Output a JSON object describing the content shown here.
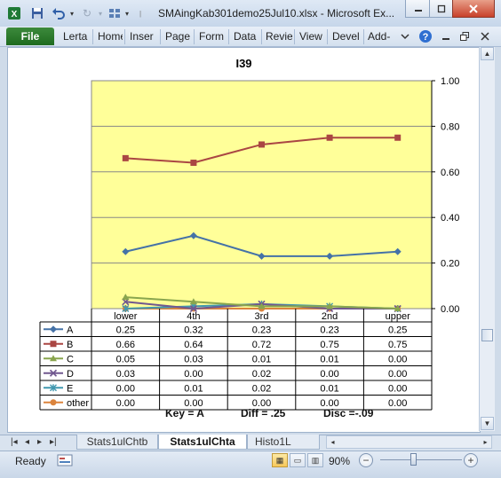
{
  "window": {
    "title": "SMAingKab301demo25Jul10.xlsx  -  Microsoft Ex..."
  },
  "ribbon": {
    "file_tab": "File",
    "tabs": [
      "Lerta",
      "Home",
      "Inser",
      "Page",
      "Form",
      "Data",
      "Revie",
      "View",
      "Devel",
      "Add-"
    ]
  },
  "icons": {
    "app": "excel-icon",
    "save": "save-icon",
    "undo": "undo-icon",
    "redo": "redo-icon",
    "customize": "customize-icon"
  },
  "colors": {
    "plot_bg": "#ffff99",
    "A": "#4572a7",
    "B": "#aa4643",
    "C": "#89a54e",
    "D": "#71588f",
    "E": "#4198af",
    "other": "#db843d"
  },
  "chart_data": {
    "type": "line",
    "title": "I39",
    "categories": [
      "lower",
      "4th",
      "3rd",
      "2nd",
      "upper"
    ],
    "ylim": [
      0,
      1
    ],
    "yticks": [
      "0.00",
      "0.20",
      "0.40",
      "0.60",
      "0.80",
      "1.00"
    ],
    "grid": true,
    "series": [
      {
        "name": "A",
        "values": [
          0.25,
          0.32,
          0.23,
          0.23,
          0.25
        ],
        "labels": [
          "0.25",
          "0.32",
          "0.23",
          "0.23",
          "0.25"
        ]
      },
      {
        "name": "B",
        "values": [
          0.66,
          0.64,
          0.72,
          0.75,
          0.75
        ],
        "labels": [
          "0.66",
          "0.64",
          "0.72",
          "0.75",
          "0.75"
        ]
      },
      {
        "name": "C",
        "values": [
          0.05,
          0.03,
          0.01,
          0.01,
          0.0
        ],
        "labels": [
          "0.05",
          "0.03",
          "0.01",
          "0.01",
          "0.00"
        ]
      },
      {
        "name": "D",
        "values": [
          0.03,
          0.0,
          0.02,
          0.0,
          0.0
        ],
        "labels": [
          "0.03",
          "0.00",
          "0.02",
          "0.00",
          "0.00"
        ]
      },
      {
        "name": "E",
        "values": [
          0.0,
          0.01,
          0.02,
          0.01,
          0.0
        ],
        "labels": [
          "0.00",
          "0.01",
          "0.02",
          "0.01",
          "0.00"
        ]
      },
      {
        "name": "other",
        "values": [
          0.0,
          0.0,
          0.0,
          0.0,
          0.0
        ],
        "labels": [
          "0.00",
          "0.00",
          "0.00",
          "0.00",
          "0.00"
        ]
      }
    ],
    "footer": {
      "key": "Key = A",
      "diff": "Diff = .25",
      "disc": "Disc =-.09"
    }
  },
  "sheets": {
    "tabs": [
      "Stats1ulChtb",
      "Stats1ulChta",
      "Histo1L"
    ],
    "active": "Stats1ulChta"
  },
  "status": {
    "ready": "Ready",
    "zoom": "90%",
    "zoom_level_percent": 90
  }
}
